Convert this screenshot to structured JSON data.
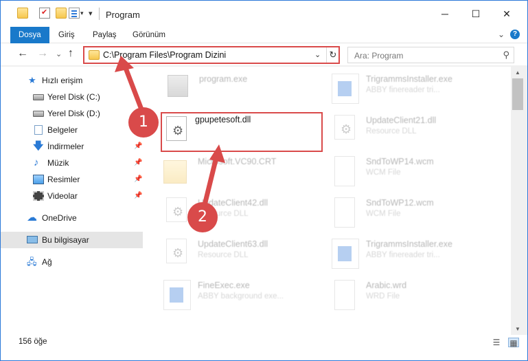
{
  "window": {
    "title": "Program",
    "minimize_icon": "─",
    "maximize_icon": "☐",
    "close_icon": "✕"
  },
  "quick_access": {
    "dropdown_glyph": "▾",
    "customize_glyph": "▾"
  },
  "ribbon": {
    "tabs": [
      "Dosya",
      "Giriş",
      "Paylaş",
      "Görünüm"
    ],
    "expand_glyph": "⌄",
    "help_glyph": "?"
  },
  "nav": {
    "back_glyph": "←",
    "forward_glyph": "→",
    "recent_glyph": "⌄",
    "up_glyph": "↑",
    "address": "C:\\Program Files\\Program Dizini",
    "address_dropdown_glyph": "⌄",
    "refresh_glyph": "↻",
    "search_placeholder": "Ara: Program",
    "search_glyph": "⚲"
  },
  "sidebar": {
    "items": [
      {
        "label": "Hızlı erişim",
        "icon": "star-icon",
        "glyph": "★"
      },
      {
        "label": "Yerel Disk (C:)",
        "icon": "disk-icon",
        "glyph": ""
      },
      {
        "label": "Yerel Disk (D:)",
        "icon": "disk-icon",
        "glyph": ""
      },
      {
        "label": "Belgeler",
        "icon": "document-icon",
        "glyph": ""
      },
      {
        "label": "İndirmeler",
        "icon": "download-icon",
        "glyph": "🡇"
      },
      {
        "label": "Müzik",
        "icon": "music-icon",
        "glyph": "♪"
      },
      {
        "label": "Resimler",
        "icon": "pictures-icon",
        "glyph": ""
      },
      {
        "label": "Videolar",
        "icon": "video-icon",
        "glyph": ""
      },
      {
        "label": "OneDrive",
        "icon": "cloud-icon",
        "glyph": "☁"
      },
      {
        "label": "Bu bilgisayar",
        "icon": "computer-icon",
        "glyph": ""
      },
      {
        "label": "Ağ",
        "icon": "network-icon",
        "glyph": "🖧"
      }
    ],
    "pin_glyph": "📌",
    "selected": "Bu bilgisayar"
  },
  "files": [
    {
      "name": "program.exe",
      "desc": "",
      "icon": "exe-icon"
    },
    {
      "name": "TrigrammsInstaller.exe",
      "desc": "ABBY finereader tri...",
      "icon": "app-icon"
    },
    {
      "name": "gpupetesoft.dll",
      "desc": "",
      "icon": "dll-icon"
    },
    {
      "name": "UpdateClient21.dll",
      "desc": "Resource DLL",
      "icon": "dll-icon"
    },
    {
      "name": "Microsoft.VC90.CRT",
      "desc": "",
      "icon": "folder-icon"
    },
    {
      "name": "SndToWP14.wcm",
      "desc": "WCM File",
      "icon": "file-icon"
    },
    {
      "name": "UpdateClient42.dll",
      "desc": "Resource DLL",
      "icon": "dll-icon"
    },
    {
      "name": "SndToWP12.wcm",
      "desc": "WCM File",
      "icon": "file-icon"
    },
    {
      "name": "UpdateClient63.dll",
      "desc": "Resource DLL",
      "icon": "dll-icon"
    },
    {
      "name": "TrigrammsInstaller.exe",
      "desc": "ABBY finereader tri...",
      "icon": "app-icon"
    },
    {
      "name": "FineExec.exe",
      "desc": "ABBY background exe...",
      "icon": "app-icon"
    },
    {
      "name": "Arabic.wrd",
      "desc": "WRD File",
      "icon": "file-icon"
    }
  ],
  "annotations": {
    "step1": "1",
    "step2": "2"
  },
  "scrollbar": {
    "up_glyph": "▲",
    "down_glyph": "▼"
  },
  "status": {
    "count": "156 öğe",
    "details_view_glyph": "☰",
    "tiles_view_glyph": "▦"
  },
  "colors": {
    "accent": "#1979ca",
    "highlight": "#d94a4a"
  }
}
